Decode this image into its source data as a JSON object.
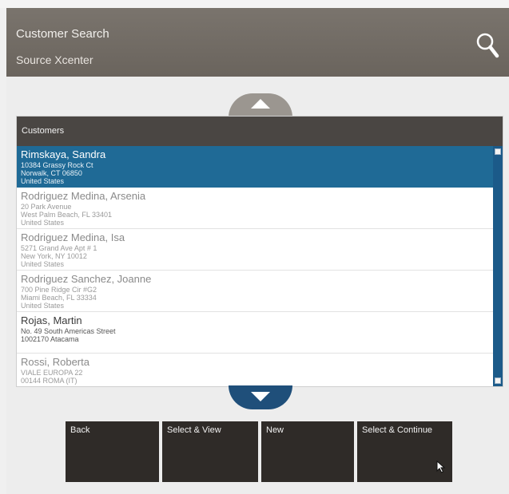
{
  "header": {
    "title": "Customer Search",
    "subtitle": "Source Xcenter",
    "search_icon": "search-icon"
  },
  "panel": {
    "title": "Customers"
  },
  "customers": [
    {
      "name": "Rimskaya, Sandra",
      "line1": "10384 Grassy Rock Ct",
      "line2": "Norwalk, CT 06850",
      "line3": "United States",
      "selected": true
    },
    {
      "name": "Rodriguez Medina, Arsenia",
      "line1": "20 Park Avenue",
      "line2": "West Palm Beach, FL 33401",
      "line3": "United States"
    },
    {
      "name": "Rodriguez Medina, Isa",
      "line1": "5271 Grand Ave Apt # 1",
      "line2": "New York, NY 10012",
      "line3": "United States"
    },
    {
      "name": "Rodriguez Sanchez, Joanne",
      "line1": "700 Pine Ridge Cir #G2",
      "line2": "Miami Beach, FL 33334",
      "line3": "United States"
    },
    {
      "name": "Rojas, Martin",
      "line1": "No. 49 South Americas Street",
      "line2": "1002170 Atacama",
      "line3": ""
    },
    {
      "name": "Rossi, Roberta",
      "line1": "VIALE EUROPA 22",
      "line2": "00144 ROMA (IT)",
      "line3": ""
    }
  ],
  "buttons": {
    "back": "Back",
    "select_view": "Select & View",
    "new": "New",
    "select_continue": "Select & Continue"
  },
  "colors": {
    "header_bg": "#736d66",
    "selected_row": "#1f6a96",
    "scroll_down": "#1f4f7a",
    "scroll_up": "#9b9690",
    "button_bg": "#2f2b28",
    "panel_header": "#4a4643"
  }
}
